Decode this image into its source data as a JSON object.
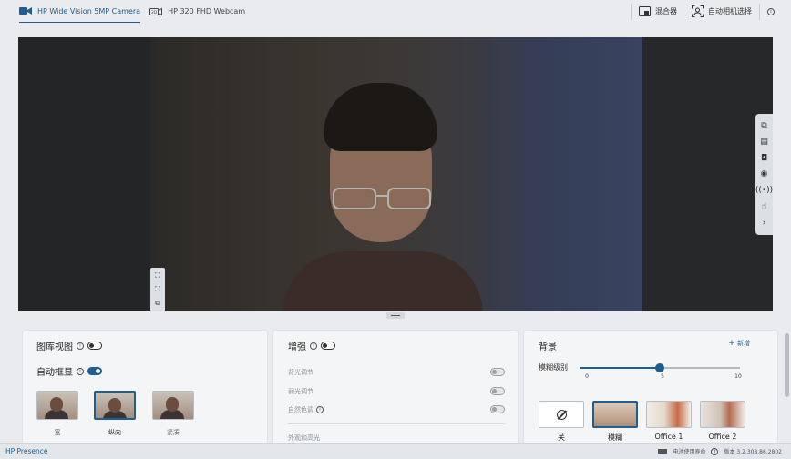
{
  "top": {
    "tabs": [
      {
        "label": "HP Wide Vision 5MP Camera",
        "icon": "camera-icon",
        "active": true
      },
      {
        "label": "HP 320 FHD Webcam",
        "icon": "webcam-icon",
        "active": false
      }
    ],
    "mixer_label": "混合器",
    "auto_camera_label": "自动相机选择"
  },
  "panel_gallery": {
    "gallery_view_label": "图库视图",
    "auto_frame_label": "自动框显",
    "frames": [
      {
        "label": "宽",
        "selected": false
      },
      {
        "label": "纵向",
        "selected": true
      },
      {
        "label": "紧凑",
        "selected": false
      }
    ]
  },
  "panel_enhance": {
    "title": "增强",
    "items": [
      "背光调节",
      "弱光调节",
      "自然色调"
    ],
    "next_label": "外观和高光"
  },
  "panel_background": {
    "title": "背景",
    "add_label": "新增",
    "blur_label": "模糊级别",
    "slider": {
      "min": "0",
      "mid": "5",
      "max": "10",
      "value": 5,
      "max_value": 10
    },
    "options": [
      {
        "label": "关",
        "selected": false
      },
      {
        "label": "模糊",
        "selected": true
      },
      {
        "label": "Office 1",
        "selected": false
      },
      {
        "label": "Office 2",
        "selected": false
      }
    ]
  },
  "footer": {
    "app_name": "HP Presence",
    "battery_label": "电池使用寿命",
    "version_label": "版本 3.2.308.86.2802"
  },
  "colors": {
    "accent": "#1f5e8e"
  }
}
